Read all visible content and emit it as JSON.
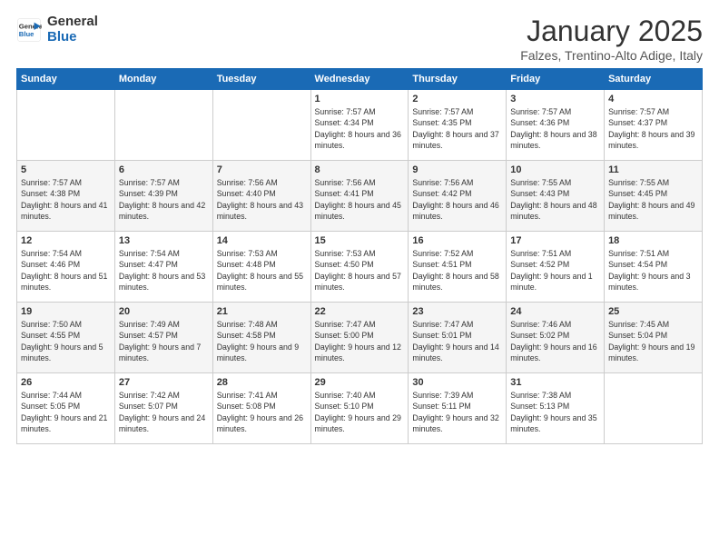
{
  "header": {
    "logo_line1": "General",
    "logo_line2": "Blue",
    "month": "January 2025",
    "location": "Falzes, Trentino-Alto Adige, Italy"
  },
  "days_of_week": [
    "Sunday",
    "Monday",
    "Tuesday",
    "Wednesday",
    "Thursday",
    "Friday",
    "Saturday"
  ],
  "weeks": [
    [
      {
        "day": "",
        "info": ""
      },
      {
        "day": "",
        "info": ""
      },
      {
        "day": "",
        "info": ""
      },
      {
        "day": "1",
        "info": "Sunrise: 7:57 AM\nSunset: 4:34 PM\nDaylight: 8 hours and 36 minutes."
      },
      {
        "day": "2",
        "info": "Sunrise: 7:57 AM\nSunset: 4:35 PM\nDaylight: 8 hours and 37 minutes."
      },
      {
        "day": "3",
        "info": "Sunrise: 7:57 AM\nSunset: 4:36 PM\nDaylight: 8 hours and 38 minutes."
      },
      {
        "day": "4",
        "info": "Sunrise: 7:57 AM\nSunset: 4:37 PM\nDaylight: 8 hours and 39 minutes."
      }
    ],
    [
      {
        "day": "5",
        "info": "Sunrise: 7:57 AM\nSunset: 4:38 PM\nDaylight: 8 hours and 41 minutes."
      },
      {
        "day": "6",
        "info": "Sunrise: 7:57 AM\nSunset: 4:39 PM\nDaylight: 8 hours and 42 minutes."
      },
      {
        "day": "7",
        "info": "Sunrise: 7:56 AM\nSunset: 4:40 PM\nDaylight: 8 hours and 43 minutes."
      },
      {
        "day": "8",
        "info": "Sunrise: 7:56 AM\nSunset: 4:41 PM\nDaylight: 8 hours and 45 minutes."
      },
      {
        "day": "9",
        "info": "Sunrise: 7:56 AM\nSunset: 4:42 PM\nDaylight: 8 hours and 46 minutes."
      },
      {
        "day": "10",
        "info": "Sunrise: 7:55 AM\nSunset: 4:43 PM\nDaylight: 8 hours and 48 minutes."
      },
      {
        "day": "11",
        "info": "Sunrise: 7:55 AM\nSunset: 4:45 PM\nDaylight: 8 hours and 49 minutes."
      }
    ],
    [
      {
        "day": "12",
        "info": "Sunrise: 7:54 AM\nSunset: 4:46 PM\nDaylight: 8 hours and 51 minutes."
      },
      {
        "day": "13",
        "info": "Sunrise: 7:54 AM\nSunset: 4:47 PM\nDaylight: 8 hours and 53 minutes."
      },
      {
        "day": "14",
        "info": "Sunrise: 7:53 AM\nSunset: 4:48 PM\nDaylight: 8 hours and 55 minutes."
      },
      {
        "day": "15",
        "info": "Sunrise: 7:53 AM\nSunset: 4:50 PM\nDaylight: 8 hours and 57 minutes."
      },
      {
        "day": "16",
        "info": "Sunrise: 7:52 AM\nSunset: 4:51 PM\nDaylight: 8 hours and 58 minutes."
      },
      {
        "day": "17",
        "info": "Sunrise: 7:51 AM\nSunset: 4:52 PM\nDaylight: 9 hours and 1 minute."
      },
      {
        "day": "18",
        "info": "Sunrise: 7:51 AM\nSunset: 4:54 PM\nDaylight: 9 hours and 3 minutes."
      }
    ],
    [
      {
        "day": "19",
        "info": "Sunrise: 7:50 AM\nSunset: 4:55 PM\nDaylight: 9 hours and 5 minutes."
      },
      {
        "day": "20",
        "info": "Sunrise: 7:49 AM\nSunset: 4:57 PM\nDaylight: 9 hours and 7 minutes."
      },
      {
        "day": "21",
        "info": "Sunrise: 7:48 AM\nSunset: 4:58 PM\nDaylight: 9 hours and 9 minutes."
      },
      {
        "day": "22",
        "info": "Sunrise: 7:47 AM\nSunset: 5:00 PM\nDaylight: 9 hours and 12 minutes."
      },
      {
        "day": "23",
        "info": "Sunrise: 7:47 AM\nSunset: 5:01 PM\nDaylight: 9 hours and 14 minutes."
      },
      {
        "day": "24",
        "info": "Sunrise: 7:46 AM\nSunset: 5:02 PM\nDaylight: 9 hours and 16 minutes."
      },
      {
        "day": "25",
        "info": "Sunrise: 7:45 AM\nSunset: 5:04 PM\nDaylight: 9 hours and 19 minutes."
      }
    ],
    [
      {
        "day": "26",
        "info": "Sunrise: 7:44 AM\nSunset: 5:05 PM\nDaylight: 9 hours and 21 minutes."
      },
      {
        "day": "27",
        "info": "Sunrise: 7:42 AM\nSunset: 5:07 PM\nDaylight: 9 hours and 24 minutes."
      },
      {
        "day": "28",
        "info": "Sunrise: 7:41 AM\nSunset: 5:08 PM\nDaylight: 9 hours and 26 minutes."
      },
      {
        "day": "29",
        "info": "Sunrise: 7:40 AM\nSunset: 5:10 PM\nDaylight: 9 hours and 29 minutes."
      },
      {
        "day": "30",
        "info": "Sunrise: 7:39 AM\nSunset: 5:11 PM\nDaylight: 9 hours and 32 minutes."
      },
      {
        "day": "31",
        "info": "Sunrise: 7:38 AM\nSunset: 5:13 PM\nDaylight: 9 hours and 35 minutes."
      },
      {
        "day": "",
        "info": ""
      }
    ]
  ]
}
